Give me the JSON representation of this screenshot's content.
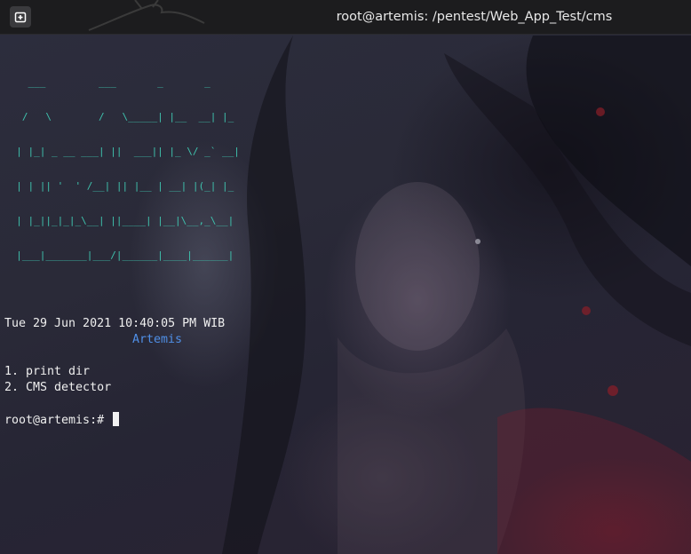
{
  "window": {
    "title": "root@artemis: /pentest/Web_App_Test/cms",
    "new_tab_icon": "new-tab-icon"
  },
  "banner": {
    "lines": [
      "    ___         ___       _       _   ",
      "   /   \\        /   \\_____| |__  __| |_ ",
      "  | |_| _ __ ___| ||  ___|| |_ \\/ _` __|",
      "  | | || '  ' /__| || |__ | __| |(_| |_ ",
      "  | |_||_|_|_\\__| ||____| |__|\\__,_\\__|",
      "  |___|_______|___/|______|____|______| "
    ],
    "color": "#3fc3ae"
  },
  "terminal": {
    "date_line": "Tue 29 Jun 2021 10:40:05 PM WIB",
    "hostname": "Artemis",
    "menu": [
      "1. print dir",
      "2. CMS detector"
    ],
    "prompt": "root@artemis:# "
  }
}
